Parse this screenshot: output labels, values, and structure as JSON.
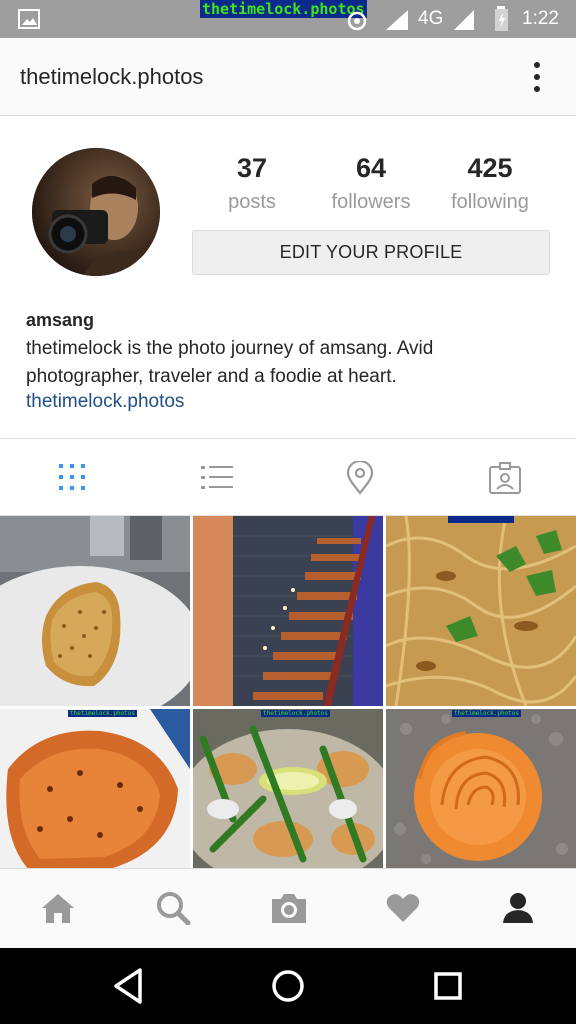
{
  "status_bar": {
    "watermark": "thetimelock.photos",
    "network": "4G",
    "time": "1:22"
  },
  "app_bar": {
    "title": "thetimelock.photos",
    "menu_icon": "more-vert-icon"
  },
  "profile": {
    "stats": [
      {
        "value": "37",
        "label": "posts"
      },
      {
        "value": "64",
        "label": "followers"
      },
      {
        "value": "425",
        "label": "following"
      }
    ],
    "edit_button_label": "EDIT YOUR PROFILE",
    "bio": {
      "name": "amsang",
      "line1": "thetimelock is the photo journey of amsang. Avid",
      "line2": "photographer, traveler and a foodie at heart.",
      "link": "thetimelock.photos"
    }
  },
  "tabs": [
    {
      "icon": "grid-icon",
      "active": true
    },
    {
      "icon": "list-icon",
      "active": false
    },
    {
      "icon": "location-pin-icon",
      "active": false
    },
    {
      "icon": "tagged-photos-icon",
      "active": false
    }
  ],
  "grid": {
    "watermark": "thetimelock.photos",
    "photos": [
      {
        "subject": "toast"
      },
      {
        "subject": "staircase"
      },
      {
        "subject": "noodles"
      },
      {
        "subject": "pizza"
      },
      {
        "subject": "stir-fry"
      },
      {
        "subject": "rose"
      }
    ]
  },
  "bottom_nav": [
    {
      "icon": "home-icon"
    },
    {
      "icon": "search-icon"
    },
    {
      "icon": "camera-icon"
    },
    {
      "icon": "heart-icon"
    },
    {
      "icon": "profile-icon",
      "active": true
    }
  ],
  "colors": {
    "active_tab": "#3897f0",
    "inactive_icon": "#999999",
    "link": "#1f4f86",
    "status_bar": "#9e9e9e"
  }
}
